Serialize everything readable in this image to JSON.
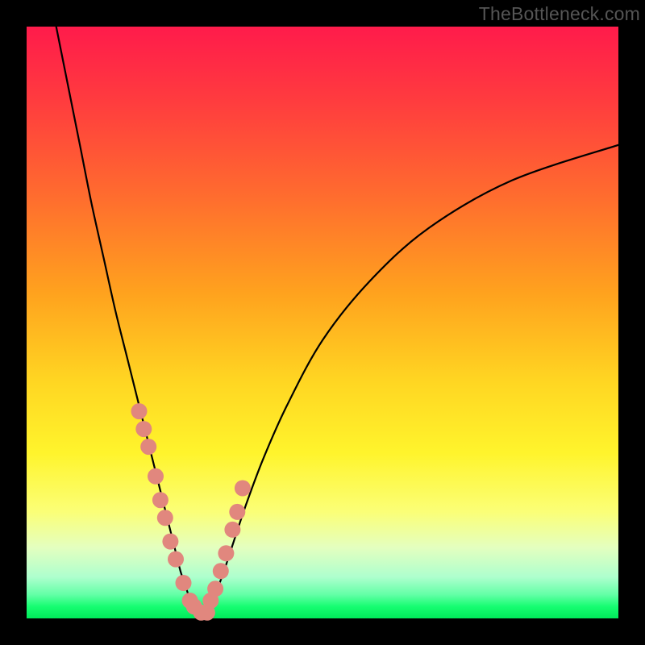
{
  "watermark": "TheBottleneck.com",
  "colors": {
    "frame": "#000000",
    "curve": "#000000",
    "marker": "#e1877e",
    "gradient_top": "#ff1b4b",
    "gradient_bottom": "#00ea5a"
  },
  "chart_data": {
    "type": "line",
    "title": "",
    "xlabel": "",
    "ylabel": "",
    "xlim": [
      0,
      100
    ],
    "ylim": [
      0,
      100
    ],
    "series": [
      {
        "name": "bottleneck-curve",
        "x": [
          5,
          7,
          9,
          11,
          13,
          15,
          17,
          19,
          21,
          23,
          24,
          25,
          26,
          27,
          28,
          29,
          30,
          31,
          33,
          35,
          37,
          40,
          44,
          50,
          58,
          68,
          82,
          100
        ],
        "y": [
          100,
          90,
          80,
          70,
          61,
          52,
          44,
          36,
          28,
          20,
          16,
          12,
          8,
          5,
          2,
          0,
          0,
          2,
          7,
          13,
          19,
          27,
          36,
          47,
          57,
          66,
          74,
          80
        ]
      }
    ],
    "markers": {
      "name": "highlight-points",
      "x": [
        19.0,
        19.8,
        20.6,
        21.8,
        22.6,
        23.4,
        24.3,
        25.2,
        26.5,
        27.6,
        28.3,
        29.5,
        30.5,
        31.1,
        31.9,
        32.8,
        33.7,
        34.8,
        35.6,
        36.5
      ],
      "y": [
        35,
        32,
        29,
        24,
        20,
        17,
        13,
        10,
        6,
        3,
        2,
        1,
        1,
        3,
        5,
        8,
        11,
        15,
        18,
        22
      ]
    }
  }
}
